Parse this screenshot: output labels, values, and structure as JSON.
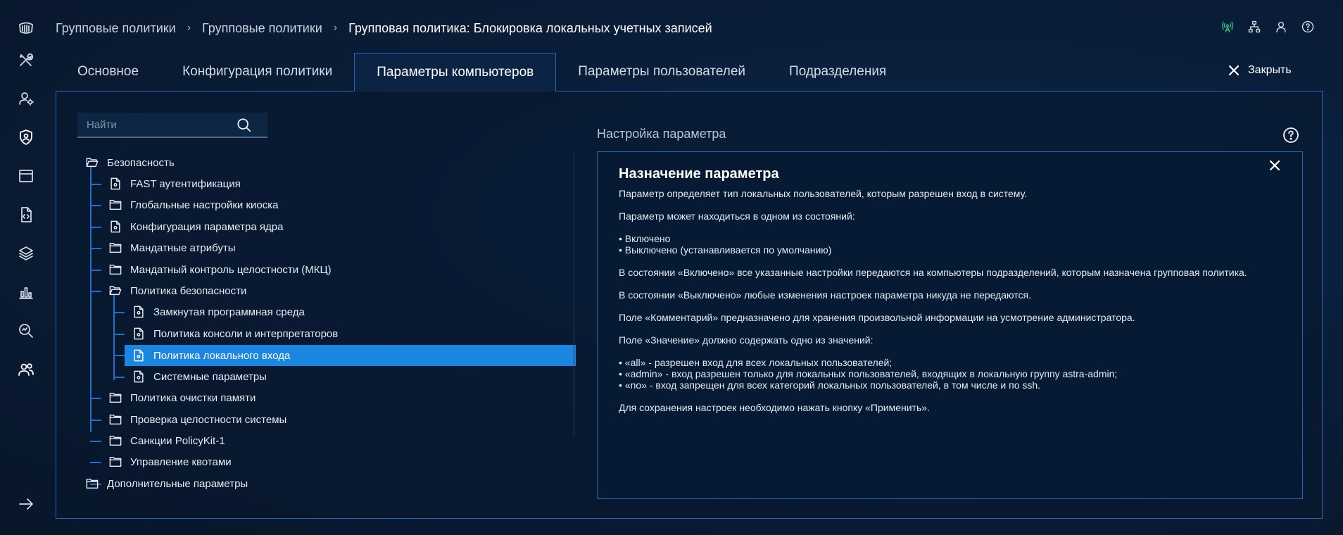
{
  "breadcrumb": {
    "item1": "Групповые политики",
    "item2": "Групповые политики",
    "current": "Групповая политика: Блокировка локальных учетных записей"
  },
  "tabs": [
    {
      "label": "Основное"
    },
    {
      "label": "Конфигурация политики"
    },
    {
      "label": "Параметры компьютеров"
    },
    {
      "label": "Параметры пользователей"
    },
    {
      "label": "Подразделения"
    }
  ],
  "active_tab": "Параметры компьютеров",
  "close_label": "Закрыть",
  "search": {
    "placeholder": "Найти"
  },
  "tree": {
    "root": "Безопасность",
    "items": [
      "FAST аутентификация",
      "Глобальные настройки киоска",
      "Конфигурация параметра ядра",
      "Мандатные атрибуты",
      "Мандатный контроль целостности (МКЦ)",
      "Политика безопасности",
      "Политика очистки памяти",
      "Проверка целостности системы",
      "Санкции PolicyKit-1",
      "Управление квотами"
    ],
    "sub_items": [
      "Замкнутая программная среда",
      "Политика консоли и интерпретаторов",
      "Политика локального входа",
      "Системные параметры"
    ],
    "root2": "Дополнительные параметры",
    "selected": "Политика локального входа"
  },
  "param": {
    "section_title": "Настройка параметра",
    "heading": "Назначение параметра",
    "p1": "Параметр определяет тип локальных пользователей, которым разрешен вход в систему.",
    "p2": "Параметр может находиться в одном из состояний:",
    "states": [
      "Включено",
      "Выключено (устанавливается по умолчанию)"
    ],
    "p3": "В состоянии «Включено» все указанные настройки передаются на компьютеры подразделений, которым назначена групповая политика.",
    "p4": "В состоянии «Выключено» любые изменения настроек параметра никуда не передаются.",
    "p5": "Поле «Комментарий» предназначено для хранения произвольной информации на усмотрение администратора.",
    "p6": "Поле «Значение» должно содержать одно из значений:",
    "values": [
      "«all» - разрешен вход для всех локальных пользователей;",
      "«admin» - вход разрешен только для локальных пользователей, входящих в локальную группу astra-admin;",
      "«no» - вход запрещен для всех категорий локальных пользователей, в том числе и по ssh."
    ],
    "p7": "Для сохранения настроек необходимо нажать кнопку «Применить»."
  },
  "colors": {
    "accent": "#1a86e0",
    "border": "#1f66b8",
    "background": "#0a1d38",
    "status_green": "#2ec27e"
  }
}
